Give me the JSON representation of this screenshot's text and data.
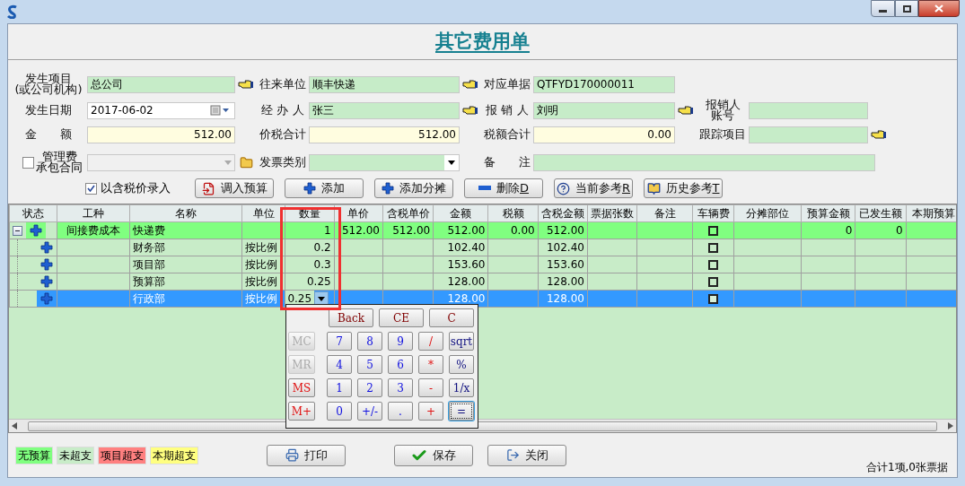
{
  "heading": "其它费用单",
  "form": {
    "rows": [
      [
        {
          "kind": "text",
          "label": [
            "发生项目",
            "(或公司机构)"
          ],
          "value": "总公司"
        },
        {
          "kind": "text",
          "label": [
            "往来单位"
          ],
          "value": "顺丰快递"
        },
        {
          "kind": "text",
          "label": [
            "对应单据"
          ],
          "value": "QTFYD170000011"
        }
      ],
      [
        {
          "kind": "date",
          "label": [
            "发生日期"
          ],
          "value": "2017-06-02"
        },
        {
          "kind": "text",
          "label": [
            "经 办 人"
          ],
          "value": "张三"
        },
        {
          "kind": "text",
          "label": [
            "报 销 人"
          ],
          "value": "刘明"
        },
        {
          "kind": "text",
          "label": [
            "报销人",
            "账号"
          ]
        }
      ],
      [
        {
          "kind": "amount",
          "label": [
            "金　　额"
          ],
          "value": "512.00"
        },
        {
          "kind": "amount",
          "label": [
            "价税合计"
          ],
          "value": "512.00"
        },
        {
          "kind": "amount",
          "label": [
            "税额合计"
          ],
          "value": "0.00"
        },
        {
          "kind": "text",
          "label": [
            "跟踪项目"
          ]
        }
      ],
      [
        {
          "kind": "check-combo",
          "label": [
            "管理费",
            "承包合同"
          ],
          "checked": false
        },
        {
          "kind": "combo",
          "label": [
            "发票类别"
          ]
        },
        {
          "kind": "memo",
          "label": [
            "备　　注"
          ]
        }
      ]
    ]
  },
  "toolbar": {
    "checkbox": {
      "label": "以含税价录入",
      "checked": true
    },
    "buttons": [
      {
        "label": "调入预算"
      },
      {
        "label": "添加"
      },
      {
        "label": "添加分摊"
      },
      {
        "label": "删除",
        "hotkey": "D"
      },
      {
        "label": "当前参考",
        "hotkey": "R"
      },
      {
        "label": "历史参考",
        "hotkey": "T"
      }
    ]
  },
  "table": {
    "columns": [
      {
        "label": "状态",
        "kind": "status"
      },
      {
        "label": "工种",
        "kind": "center"
      },
      {
        "label": "名称",
        "kind": "text"
      },
      {
        "label": "单位",
        "kind": "text"
      },
      {
        "label": "数量",
        "kind": "number"
      },
      {
        "label": "单价",
        "kind": "number"
      },
      {
        "label": "含税单价",
        "kind": "number"
      },
      {
        "label": "金额",
        "kind": "number"
      },
      {
        "label": "税额",
        "kind": "number"
      },
      {
        "label": "含税金额",
        "kind": "number"
      },
      {
        "label": "票据张数",
        "kind": "number"
      },
      {
        "label": "备注",
        "kind": "text"
      },
      {
        "label": "车辆费",
        "kind": "check"
      },
      {
        "label": "分摊部位",
        "kind": "text"
      },
      {
        "label": "预算金额",
        "kind": "number"
      },
      {
        "label": "已发生额",
        "kind": "number"
      },
      {
        "label": "本期预算",
        "kind": "number"
      }
    ],
    "rows": [
      {
        "kind": "parent",
        "expanded": true,
        "selected": false,
        "cells": [
          null,
          "间接费成本",
          "快递费",
          null,
          "1",
          "512.00",
          "512.00",
          "512.00",
          "0.00",
          "512.00",
          null,
          null,
          false,
          null,
          "0",
          "0",
          null
        ]
      },
      {
        "kind": "child",
        "selected": false,
        "cells": [
          null,
          null,
          "财务部",
          "按比例",
          "0.2",
          null,
          null,
          "102.40",
          null,
          "102.40",
          null,
          null,
          false,
          null,
          null,
          null,
          null
        ]
      },
      {
        "kind": "child",
        "selected": false,
        "cells": [
          null,
          null,
          "项目部",
          "按比例",
          "0.3",
          null,
          null,
          "153.60",
          null,
          "153.60",
          null,
          null,
          false,
          null,
          null,
          null,
          null
        ]
      },
      {
        "kind": "child",
        "selected": false,
        "cells": [
          null,
          null,
          "预算部",
          "按比例",
          "0.25",
          null,
          null,
          "128.00",
          null,
          "128.00",
          null,
          null,
          false,
          null,
          null,
          null,
          null
        ]
      },
      {
        "kind": "child",
        "selected": true,
        "editor": "0.25",
        "cells": [
          null,
          null,
          "行政部",
          "按比例",
          null,
          null,
          null,
          "128.00",
          null,
          "128.00",
          null,
          null,
          false,
          null,
          null,
          null,
          null
        ]
      }
    ]
  },
  "calculator": {
    "top_keys": [
      {
        "label": "Back",
        "kind": "clear"
      },
      {
        "label": "CE",
        "kind": "clear"
      },
      {
        "label": "C",
        "kind": "clear"
      }
    ],
    "rows": [
      [
        {
          "label": "MC",
          "kind": "memory",
          "disabled": true
        },
        {
          "label": "7",
          "kind": "digit"
        },
        {
          "label": "8",
          "kind": "digit"
        },
        {
          "label": "9",
          "kind": "digit"
        },
        {
          "label": "/",
          "kind": "operator"
        },
        {
          "label": "sqrt",
          "kind": "function"
        }
      ],
      [
        {
          "label": "MR",
          "kind": "memory",
          "disabled": true
        },
        {
          "label": "4",
          "kind": "digit"
        },
        {
          "label": "5",
          "kind": "digit"
        },
        {
          "label": "6",
          "kind": "digit"
        },
        {
          "label": "*",
          "kind": "operator"
        },
        {
          "label": "%",
          "kind": "function"
        }
      ],
      [
        {
          "label": "MS",
          "kind": "memory",
          "disabled": false
        },
        {
          "label": "1",
          "kind": "digit"
        },
        {
          "label": "2",
          "kind": "digit"
        },
        {
          "label": "3",
          "kind": "digit"
        },
        {
          "label": "-",
          "kind": "operator"
        },
        {
          "label": "1/x",
          "kind": "function"
        }
      ],
      [
        {
          "label": "M+",
          "kind": "memory",
          "disabled": false
        },
        {
          "label": "0",
          "kind": "digit"
        },
        {
          "label": "+/-",
          "kind": "digit"
        },
        {
          "label": ".",
          "kind": "digit"
        },
        {
          "label": "+",
          "kind": "operator"
        },
        {
          "label": "=",
          "kind": "function",
          "focused": true
        }
      ]
    ]
  },
  "legend": [
    {
      "label": "无预算",
      "color": "#80ff80"
    },
    {
      "label": "未超支",
      "color": "#c8ecc8"
    },
    {
      "label": "项目超支",
      "color": "#ff8080"
    },
    {
      "label": "本期超支",
      "color": "#ffff80"
    }
  ],
  "footer_buttons": [
    {
      "label": "打印"
    },
    {
      "label": "保存"
    },
    {
      "label": "关闭"
    }
  ],
  "summary": "合计1项,0张票据"
}
